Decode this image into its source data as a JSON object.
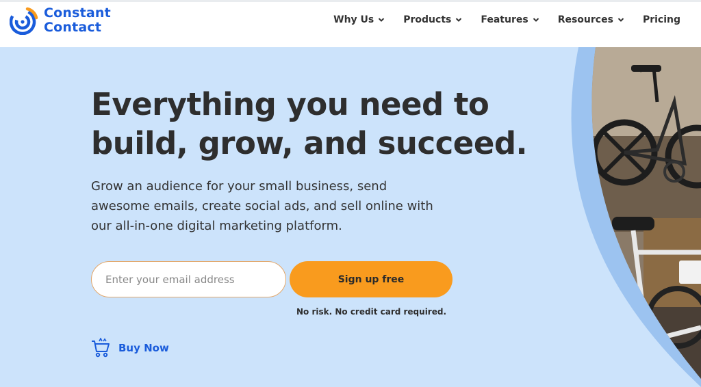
{
  "brand": {
    "line1": "Constant",
    "line2": "Contact",
    "logo_icon": "constant-contact-logo-icon",
    "colors": {
      "blue": "#1a5cdb",
      "orange": "#f99b1e"
    }
  },
  "nav": {
    "items": [
      {
        "label": "Why Us",
        "has_dropdown": true
      },
      {
        "label": "Products",
        "has_dropdown": true
      },
      {
        "label": "Features",
        "has_dropdown": true
      },
      {
        "label": "Resources",
        "has_dropdown": true
      },
      {
        "label": "Pricing",
        "has_dropdown": false
      }
    ]
  },
  "hero": {
    "headline_line1": "Everything you need to",
    "headline_line2": "build, grow, and succeed.",
    "subtext": "Grow an audience for your small business, send awesome emails, create social ads, and sell online with our all-in-one digital marketing platform.",
    "email_placeholder": "Enter your email address",
    "email_value": "",
    "signup_label": "Sign up free",
    "disclaimer": "No risk. No credit card required.",
    "buy_label": "Buy Now",
    "buy_icon": "shopping-cart-icon",
    "background_color": "#cce3fb",
    "image_subject": "bicycles hanging on a wall"
  }
}
